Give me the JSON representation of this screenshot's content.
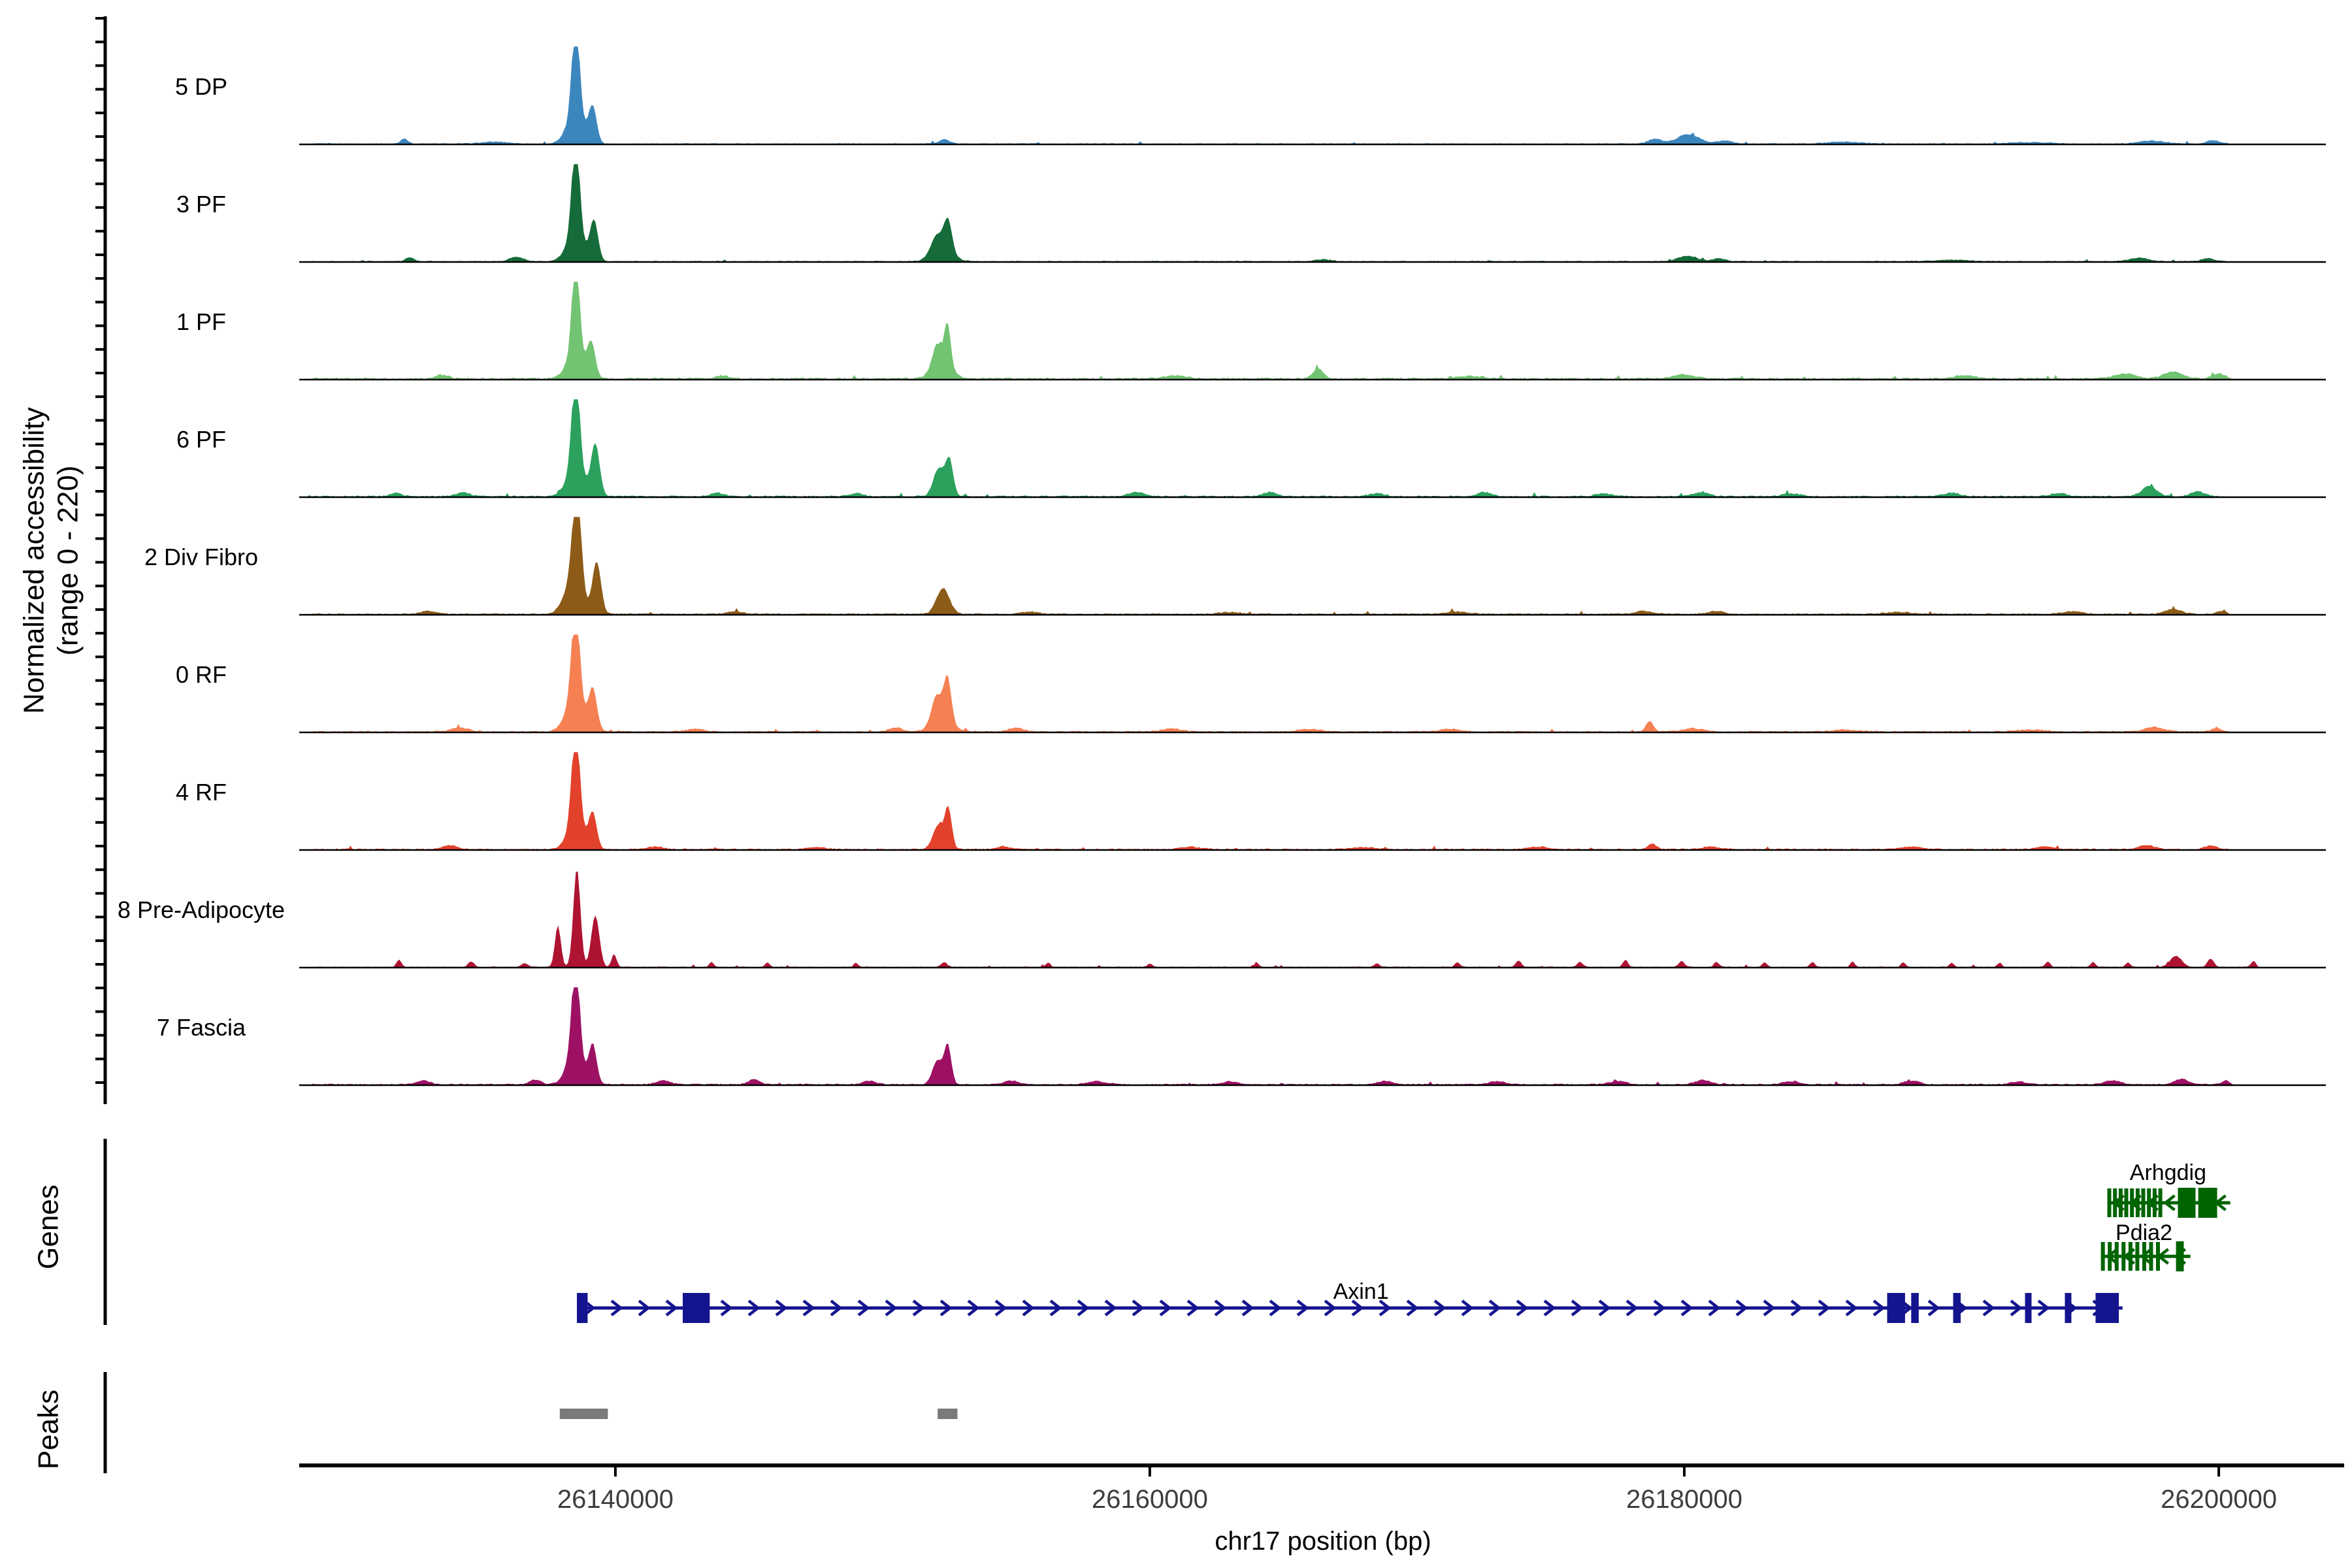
{
  "chart_data": {
    "type": "area",
    "title": "",
    "xlabel": "chr17 position (bp)",
    "ylabel": [
      "Normalized accessibility",
      "(range 0 - 220)"
    ],
    "section_labels": {
      "genes": "Genes",
      "peaks": "Peaks"
    },
    "region": {
      "chrom": "chr17",
      "start": 26128170,
      "end": 26204790
    },
    "signal_range": [
      26128400,
      26200600
    ],
    "x_ticks": [
      26140000,
      26160000,
      26180000,
      26200000
    ],
    "track_value_range": [
      0,
      220
    ],
    "tracks": [
      {
        "label": "5 DP",
        "color": "#3C86BE",
        "noise": 0.012,
        "features": [
          [
            26138520,
            1.0,
            140
          ],
          [
            26139150,
            0.36,
            150
          ],
          [
            26138500,
            0.28,
            320
          ],
          [
            26132100,
            0.055,
            130
          ],
          [
            26135500,
            0.02,
            500
          ],
          [
            26152300,
            0.045,
            200
          ],
          [
            26178900,
            0.05,
            250
          ],
          [
            26180150,
            0.095,
            420
          ],
          [
            26181500,
            0.03,
            300
          ],
          [
            26186000,
            0.02,
            600
          ],
          [
            26193000,
            0.015,
            800
          ],
          [
            26197500,
            0.03,
            500
          ],
          [
            26199800,
            0.035,
            250
          ]
        ]
      },
      {
        "label": "3 PF",
        "color": "#156B39",
        "noise": 0.012,
        "features": [
          [
            26138520,
            1.0,
            140
          ],
          [
            26139200,
            0.4,
            150
          ],
          [
            26138500,
            0.28,
            320
          ],
          [
            26132300,
            0.04,
            150
          ],
          [
            26136300,
            0.045,
            250
          ],
          [
            26152030,
            0.18,
            220
          ],
          [
            26152450,
            0.32,
            150
          ],
          [
            26152250,
            0.1,
            400
          ],
          [
            26166500,
            0.02,
            300
          ],
          [
            26180100,
            0.055,
            350
          ],
          [
            26181300,
            0.03,
            250
          ],
          [
            26190000,
            0.015,
            600
          ],
          [
            26197000,
            0.035,
            350
          ],
          [
            26199600,
            0.03,
            250
          ]
        ]
      },
      {
        "label": "1 PF",
        "color": "#72C372",
        "noise": 0.02,
        "features": [
          [
            26138520,
            1.0,
            135
          ],
          [
            26139100,
            0.34,
            150
          ],
          [
            26138500,
            0.26,
            320
          ],
          [
            26152040,
            0.26,
            180
          ],
          [
            26152430,
            0.45,
            120
          ],
          [
            26152250,
            0.1,
            400
          ],
          [
            26166300,
            0.1,
            180
          ],
          [
            26161000,
            0.03,
            400
          ],
          [
            26172000,
            0.025,
            500
          ],
          [
            26180000,
            0.04,
            400
          ],
          [
            26190500,
            0.03,
            400
          ],
          [
            26196500,
            0.05,
            400
          ],
          [
            26198300,
            0.07,
            350
          ],
          [
            26200000,
            0.05,
            250
          ],
          [
            26133500,
            0.035,
            250
          ],
          [
            26144000,
            0.03,
            250
          ]
        ]
      },
      {
        "label": "6 PF",
        "color": "#2BA15D",
        "noise": 0.017,
        "features": [
          [
            26138520,
            1.0,
            145
          ],
          [
            26139250,
            0.52,
            160
          ],
          [
            26138500,
            0.28,
            320
          ],
          [
            26152100,
            0.28,
            200
          ],
          [
            26152500,
            0.36,
            140
          ],
          [
            26131800,
            0.04,
            200
          ],
          [
            26134300,
            0.04,
            250
          ],
          [
            26143800,
            0.035,
            250
          ],
          [
            26149000,
            0.03,
            250
          ],
          [
            26159500,
            0.04,
            300
          ],
          [
            26164500,
            0.045,
            250
          ],
          [
            26168500,
            0.03,
            300
          ],
          [
            26172500,
            0.04,
            250
          ],
          [
            26177000,
            0.03,
            300
          ],
          [
            26180600,
            0.04,
            300
          ],
          [
            26184000,
            0.03,
            300
          ],
          [
            26190000,
            0.035,
            300
          ],
          [
            26194000,
            0.03,
            300
          ],
          [
            26197400,
            0.1,
            280
          ],
          [
            26199200,
            0.05,
            250
          ]
        ]
      },
      {
        "label": "2 Div Fibro",
        "color": "#8D5B18",
        "noise": 0.015,
        "features": [
          [
            26138560,
            1.0,
            160
          ],
          [
            26139300,
            0.52,
            160
          ],
          [
            26138400,
            0.32,
            320
          ],
          [
            26152260,
            0.26,
            240
          ],
          [
            26133000,
            0.03,
            300
          ],
          [
            26144500,
            0.025,
            300
          ],
          [
            26155500,
            0.025,
            300
          ],
          [
            26163000,
            0.02,
            400
          ],
          [
            26171500,
            0.025,
            400
          ],
          [
            26178500,
            0.03,
            300
          ],
          [
            26181200,
            0.03,
            300
          ],
          [
            26188000,
            0.02,
            500
          ],
          [
            26194500,
            0.025,
            400
          ],
          [
            26198300,
            0.05,
            300
          ],
          [
            26200100,
            0.03,
            200
          ]
        ]
      },
      {
        "label": "0 RF",
        "color": "#F58052",
        "noise": 0.016,
        "features": [
          [
            26138520,
            1.0,
            150
          ],
          [
            26139150,
            0.42,
            160
          ],
          [
            26138450,
            0.3,
            320
          ],
          [
            26152020,
            0.28,
            190
          ],
          [
            26152430,
            0.45,
            140
          ],
          [
            26152250,
            0.1,
            400
          ],
          [
            26134200,
            0.04,
            300
          ],
          [
            26143000,
            0.03,
            300
          ],
          [
            26150500,
            0.04,
            250
          ],
          [
            26155000,
            0.035,
            300
          ],
          [
            26160800,
            0.03,
            350
          ],
          [
            26166000,
            0.025,
            400
          ],
          [
            26171200,
            0.03,
            350
          ],
          [
            26178700,
            0.1,
            140
          ],
          [
            26180300,
            0.035,
            350
          ],
          [
            26186000,
            0.02,
            500
          ],
          [
            26193000,
            0.02,
            500
          ],
          [
            26197600,
            0.045,
            350
          ],
          [
            26199900,
            0.03,
            200
          ]
        ]
      },
      {
        "label": "4 RF",
        "color": "#E2422B",
        "noise": 0.015,
        "features": [
          [
            26138520,
            1.0,
            145
          ],
          [
            26139150,
            0.36,
            150
          ],
          [
            26138500,
            0.26,
            300
          ],
          [
            26152080,
            0.24,
            200
          ],
          [
            26152460,
            0.4,
            130
          ],
          [
            26133800,
            0.04,
            250
          ],
          [
            26141500,
            0.025,
            300
          ],
          [
            26147500,
            0.02,
            350
          ],
          [
            26154500,
            0.03,
            250
          ],
          [
            26161500,
            0.025,
            350
          ],
          [
            26168000,
            0.02,
            400
          ],
          [
            26174500,
            0.025,
            350
          ],
          [
            26178800,
            0.055,
            160
          ],
          [
            26181000,
            0.025,
            350
          ],
          [
            26188500,
            0.025,
            400
          ],
          [
            26193500,
            0.03,
            300
          ],
          [
            26197300,
            0.04,
            300
          ],
          [
            26199700,
            0.035,
            220
          ]
        ]
      },
      {
        "label": "8 Pre-Adipocyte",
        "color": "#AE1332",
        "noise": 0.011,
        "signal_end": 26201700,
        "features": [
          [
            26138560,
            1.0,
            130
          ],
          [
            26137850,
            0.42,
            110
          ],
          [
            26139250,
            0.52,
            150
          ],
          [
            26139950,
            0.13,
            90
          ],
          [
            26131900,
            0.075,
            90
          ],
          [
            26134600,
            0.055,
            110
          ],
          [
            26136600,
            0.04,
            120
          ],
          [
            26143600,
            0.05,
            80
          ],
          [
            26145700,
            0.045,
            80
          ],
          [
            26149000,
            0.04,
            80
          ],
          [
            26152300,
            0.05,
            110
          ],
          [
            26156200,
            0.045,
            80
          ],
          [
            26160000,
            0.035,
            90
          ],
          [
            26164000,
            0.04,
            80
          ],
          [
            26168500,
            0.04,
            90
          ],
          [
            26171500,
            0.05,
            90
          ],
          [
            26173800,
            0.065,
            100
          ],
          [
            26176100,
            0.05,
            110
          ],
          [
            26177800,
            0.075,
            90
          ],
          [
            26179900,
            0.065,
            100
          ],
          [
            26181200,
            0.055,
            90
          ],
          [
            26183000,
            0.045,
            90
          ],
          [
            26184800,
            0.05,
            90
          ],
          [
            26186300,
            0.055,
            80
          ],
          [
            26188200,
            0.045,
            90
          ],
          [
            26190000,
            0.04,
            90
          ],
          [
            26191800,
            0.045,
            80
          ],
          [
            26193600,
            0.055,
            90
          ],
          [
            26195300,
            0.05,
            90
          ],
          [
            26196600,
            0.045,
            90
          ],
          [
            26198400,
            0.11,
            220
          ],
          [
            26199700,
            0.085,
            120
          ],
          [
            26201300,
            0.06,
            90
          ]
        ]
      },
      {
        "label": "7 Fascia",
        "color": "#9D1164",
        "noise": 0.015,
        "features": [
          [
            26138520,
            1.0,
            145
          ],
          [
            26139150,
            0.4,
            150
          ],
          [
            26138450,
            0.28,
            300
          ],
          [
            26152060,
            0.24,
            190
          ],
          [
            26152440,
            0.38,
            130
          ],
          [
            26132800,
            0.04,
            250
          ],
          [
            26137000,
            0.05,
            200
          ],
          [
            26141800,
            0.04,
            250
          ],
          [
            26145200,
            0.05,
            220
          ],
          [
            26149500,
            0.035,
            250
          ],
          [
            26154800,
            0.04,
            250
          ],
          [
            26158000,
            0.035,
            300
          ],
          [
            26163000,
            0.03,
            300
          ],
          [
            26168800,
            0.035,
            300
          ],
          [
            26173000,
            0.03,
            300
          ],
          [
            26177500,
            0.035,
            300
          ],
          [
            26180700,
            0.045,
            280
          ],
          [
            26184000,
            0.03,
            300
          ],
          [
            26188500,
            0.035,
            300
          ],
          [
            26192500,
            0.03,
            300
          ],
          [
            26196000,
            0.04,
            300
          ],
          [
            26198600,
            0.055,
            250
          ],
          [
            26200300,
            0.04,
            180
          ]
        ]
      }
    ],
    "genes": [
      {
        "name": "Arhgdig",
        "strand": "-",
        "color": "#006400",
        "row": 0,
        "start": 26195830,
        "end": 26200430,
        "label_x": 26198100,
        "exon_cluster": {
          "start": 26195830,
          "end": 26197950,
          "bars": 10
        },
        "boxes": [
          [
            26198470,
            26199130
          ],
          [
            26199230,
            26199940
          ]
        ]
      },
      {
        "name": "Pdia2",
        "strand": "-",
        "color": "#006400",
        "row": 1,
        "start": 26195590,
        "end": 26198940,
        "label_x": 26197200,
        "exon_cluster": {
          "start": 26195590,
          "end": 26197910,
          "bars": 9
        },
        "boxes": [
          [
            26198400,
            26198690
          ]
        ]
      },
      {
        "name": "Axin1",
        "strand": "+",
        "color": "#14148F",
        "row": 2,
        "start": 26138560,
        "end": 26196400,
        "label_x": 26167900,
        "boxes": [
          [
            26138560,
            26138960
          ],
          [
            26142520,
            26143530
          ],
          [
            26187590,
            26188260
          ],
          [
            26188490,
            26188770
          ],
          [
            26190060,
            26190340
          ],
          [
            26192750,
            26192980
          ],
          [
            26194240,
            26194470
          ],
          [
            26195390,
            26196260
          ]
        ]
      }
    ],
    "peak_boxes": [
      [
        26137920,
        26139720
      ],
      [
        26152060,
        26152800
      ]
    ],
    "colors": {
      "axis": "#000000",
      "tick_label": "#3D3D3D",
      "peak_box": "#7A7A7A",
      "background": "#FFFFFF"
    }
  }
}
